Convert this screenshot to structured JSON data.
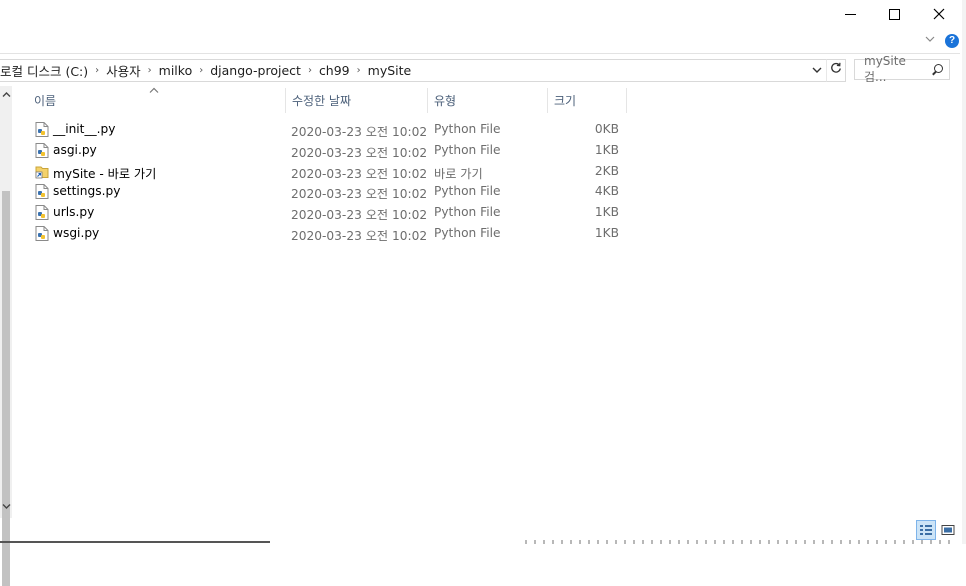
{
  "window": {
    "controls": {
      "minimize": "minimize-icon",
      "maximize": "maximize-icon",
      "close": "close-icon"
    }
  },
  "ribbon": {
    "expand_icon": "chevron-down-icon",
    "help_label": "?"
  },
  "address": {
    "crumbs": [
      "로컬 디스크 (C:)",
      "사용자",
      "milko",
      "django-project",
      "ch99",
      "mySite"
    ],
    "separator": "›"
  },
  "search": {
    "placeholder": "mySite 검..."
  },
  "columns": {
    "name": "이름",
    "date": "수정한 날짜",
    "type": "유형",
    "size": "크기"
  },
  "files": [
    {
      "name": "__init__.py",
      "date": "2020-03-23 오전 10:02",
      "type": "Python File",
      "size": "0KB",
      "icon": "python-file-icon"
    },
    {
      "name": "asgi.py",
      "date": "2020-03-23 오전 10:02",
      "type": "Python File",
      "size": "1KB",
      "icon": "python-file-icon"
    },
    {
      "name": "mySite - 바로 가기",
      "date": "2020-03-23 오전 10:02",
      "type": "바로 가기",
      "size": "2KB",
      "icon": "shortcut-folder-icon"
    },
    {
      "name": "settings.py",
      "date": "2020-03-23 오전 10:02",
      "type": "Python File",
      "size": "4KB",
      "icon": "python-file-icon"
    },
    {
      "name": "urls.py",
      "date": "2020-03-23 오전 10:02",
      "type": "Python File",
      "size": "1KB",
      "icon": "python-file-icon"
    },
    {
      "name": "wsgi.py",
      "date": "2020-03-23 오전 10:02",
      "type": "Python File",
      "size": "1KB",
      "icon": "python-file-icon"
    }
  ],
  "colors": {
    "header_text": "#4c607a",
    "accent": "#1a73d9",
    "selected_view": "#cce4f7"
  }
}
